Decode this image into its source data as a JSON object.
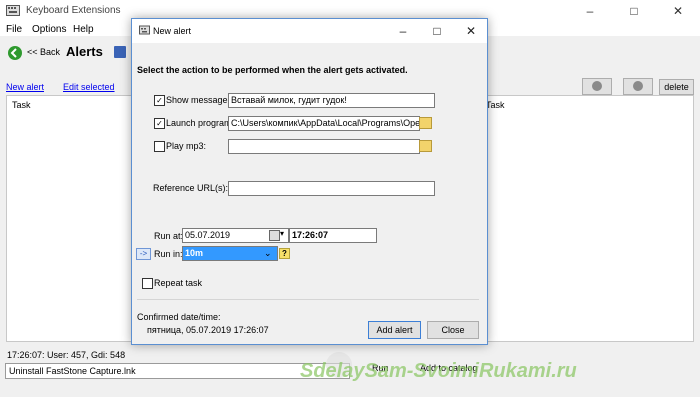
{
  "app": {
    "title": "Keyboard Extensions"
  },
  "menu": {
    "items": [
      "File",
      "Options",
      "Help"
    ]
  },
  "toolbar": {
    "back_label": "<< Back",
    "title": "Alerts"
  },
  "links": {
    "new_alert": "New alert",
    "edit_selected": "Edit selected"
  },
  "right_buttons": {
    "delete_label": "delete"
  },
  "task_list": {
    "col1": "Task",
    "col2": "Task"
  },
  "status": {
    "text": "17:26:07: User: 457, Gdi: 548"
  },
  "bottom": {
    "field_value": "Uninstall FastStone Capture.lnk",
    "run_label": "Run",
    "catalog_label": "Add to catalog"
  },
  "watermark": {
    "text": "SdelaySam-SvoimiRukami.ru"
  },
  "dialog": {
    "title": "New alert",
    "instruction": "Select the action to be performed when the alert gets activated.",
    "show_message": {
      "label": "Show message:",
      "checked": true,
      "value": "Вставай милок, гудит гудок!"
    },
    "launch_program": {
      "label": "Launch program:",
      "checked": true,
      "value": "C:\\Users\\компик\\AppData\\Local\\Programs\\Opera\\laun"
    },
    "play_mp3": {
      "label": "Play mp3:",
      "checked": false,
      "value": ""
    },
    "reference_url": {
      "label": "Reference URL(s):",
      "value": ""
    },
    "run_at": {
      "label": "Run at:",
      "date": "05.07.2019",
      "time": "17:26:07"
    },
    "run_in": {
      "arrow": "->",
      "label": "Run in:",
      "value": "10m",
      "help": "?"
    },
    "repeat_task": {
      "label": "Repeat task",
      "checked": false
    },
    "confirmed": {
      "label": "Confirmed date/time:",
      "value": "пятница, 05.07.2019 17:26:07"
    },
    "add_alert_label": "Add alert",
    "close_label": "Close"
  }
}
